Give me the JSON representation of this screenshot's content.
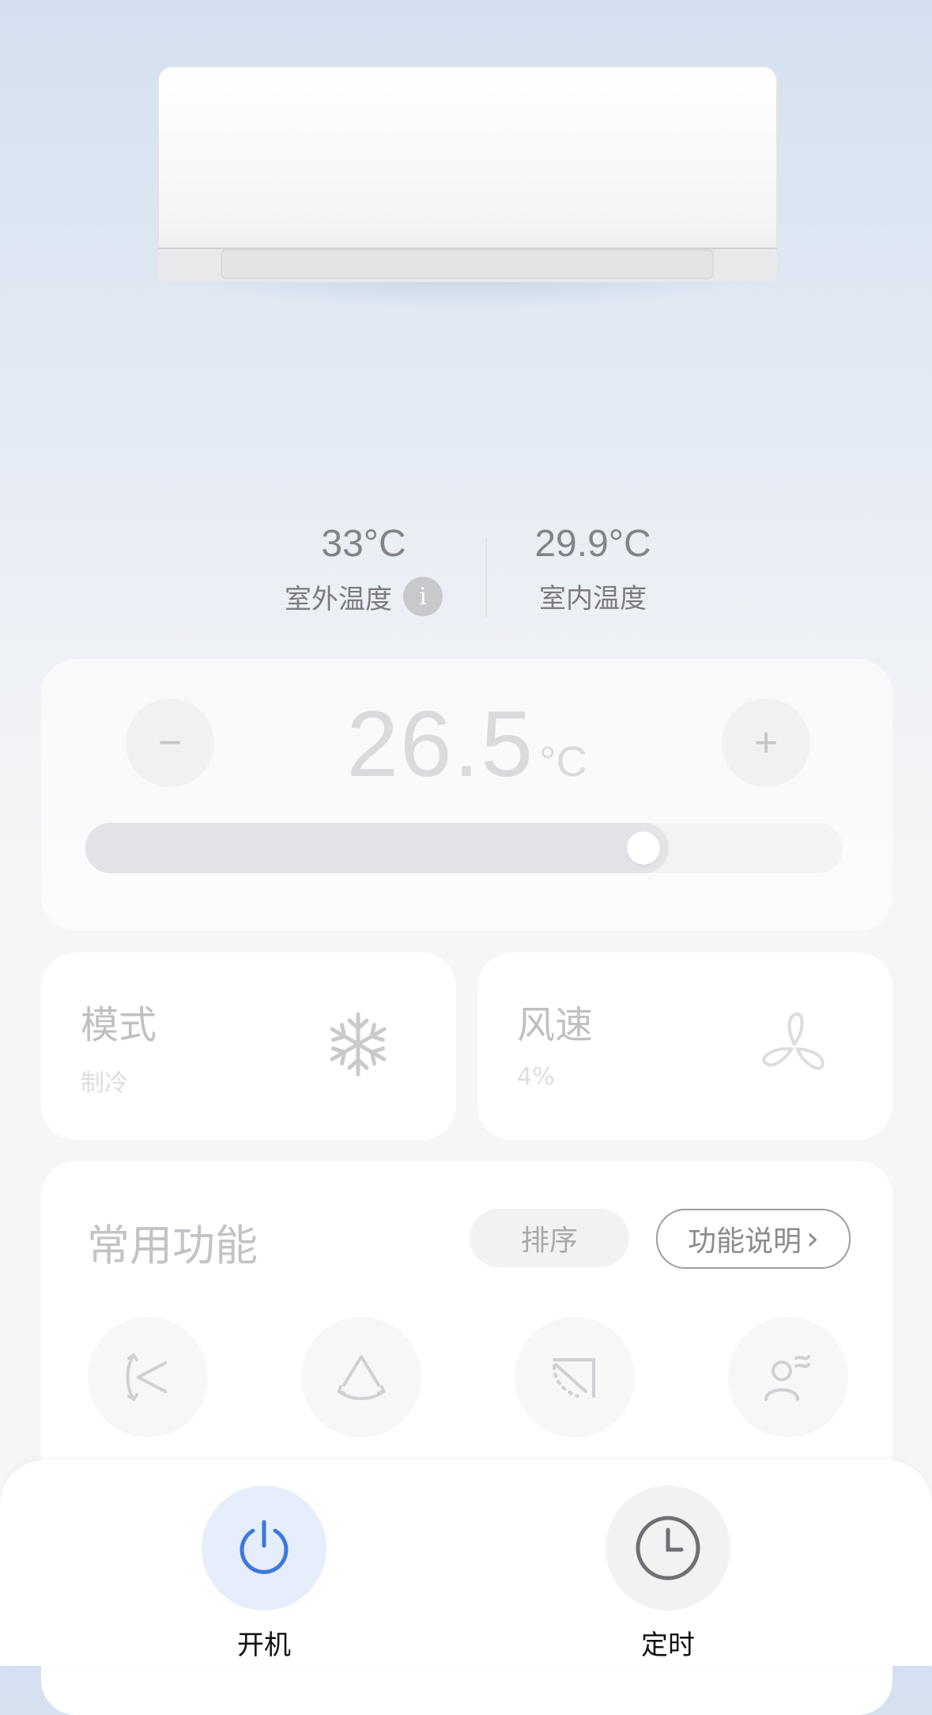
{
  "outdoor": {
    "value": "33°C",
    "label": "室外温度",
    "info_icon": "info-icon",
    "info_glyph": "i"
  },
  "indoor": {
    "value": "29.9°C",
    "label": "室内温度"
  },
  "setpoint": {
    "value": "26.5",
    "unit": "°C",
    "minus_label": "−",
    "plus_label": "+",
    "slider_fraction": 0.77
  },
  "mode_card": {
    "title": "模式",
    "value": "制冷",
    "icon": "snowflake-icon"
  },
  "fan_card": {
    "title": "风速",
    "value": "4%",
    "icon": "fan-icon"
  },
  "functions": {
    "title": "常用功能",
    "sort_label": "排序",
    "help_label": "功能说明",
    "help_chevron": "›",
    "icons": [
      "swing-vertical-icon",
      "swing-horizontal-icon",
      "airflow-direction-icon",
      "person-wind-icon"
    ]
  },
  "bottom": {
    "power_label": "开机",
    "timer_label": "定时",
    "power_icon": "power-icon",
    "timer_icon": "clock-icon"
  },
  "colors": {
    "accent": "#3d78e0",
    "accent_bg": "#e6eefb"
  }
}
